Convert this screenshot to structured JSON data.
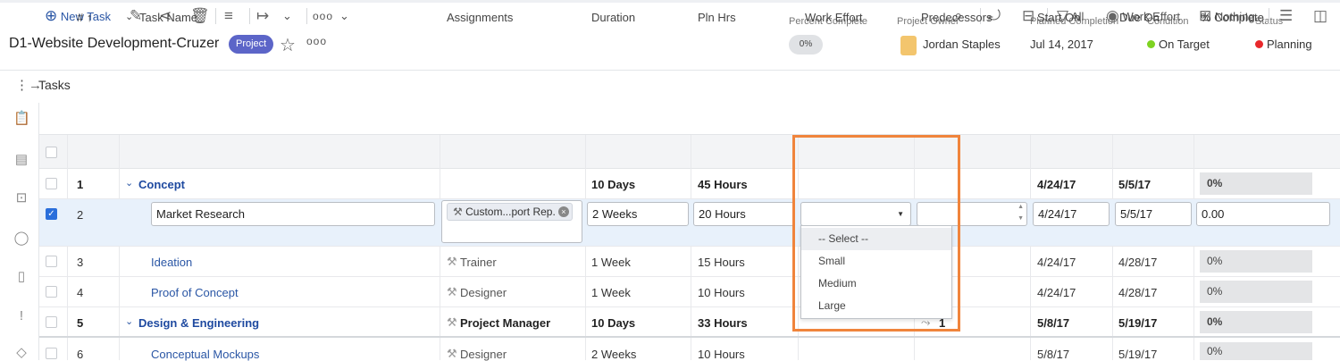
{
  "project": {
    "title": "D1-Website Development-Cruzer",
    "badge": "Project",
    "more": "ooo",
    "percent_complete_label": "Percent Complete",
    "percent_complete": "0%",
    "owner_label": "Project Owner",
    "owner": "Jordan Staples",
    "planned_label": "Planned Completion",
    "planned": "Jul 14, 2017",
    "condition_label": "Condition",
    "condition": "On Target",
    "status_label": "Status",
    "status": "Planning"
  },
  "colors": {
    "condition": "#7ed321",
    "status": "#e8282b",
    "accent": "#2a56a5",
    "highlight": "#f0843c"
  },
  "section_title": "Tasks",
  "toolbar": {
    "new_task": "New Task",
    "more": "ooo",
    "filter": "All",
    "view": "Work Effort",
    "group": "Nothing"
  },
  "columns": [
    "# ↑",
    "Task Name",
    "Assignments",
    "Duration",
    "Pln Hrs",
    "Work Effort",
    "Predecessors",
    "Start On",
    "Due On",
    "% Complete"
  ],
  "rows": [
    {
      "num": "1",
      "name": "Concept",
      "assign": "",
      "duration": "10 Days",
      "hours": "45 Hours",
      "pred": "",
      "start": "4/24/17",
      "due": "5/5/17",
      "pct": "0%"
    },
    {
      "num": "2",
      "name": "Market Research",
      "assign": "Custom...port Rep.",
      "duration": "2 Weeks",
      "hours": "20 Hours",
      "pred": "",
      "start": "4/24/17",
      "due": "5/5/17",
      "pct": "0.00"
    },
    {
      "num": "3",
      "name": "Ideation",
      "assign": "Trainer",
      "duration": "1 Week",
      "hours": "15 Hours",
      "pred": "",
      "start": "4/24/17",
      "due": "4/28/17",
      "pct": "0%"
    },
    {
      "num": "4",
      "name": "Proof of Concept",
      "assign": "Designer",
      "duration": "1 Week",
      "hours": "10 Hours",
      "pred": "",
      "start": "4/24/17",
      "due": "4/28/17",
      "pct": "0%"
    },
    {
      "num": "5",
      "name": "Design & Engineering",
      "assign": "Project Manager",
      "duration": "10 Days",
      "hours": "33 Hours",
      "pred": "1",
      "start": "5/8/17",
      "due": "5/19/17",
      "pct": "0%"
    },
    {
      "num": "6",
      "name": "Conceptual Mockups",
      "assign": "Designer",
      "duration": "2 Weeks",
      "hours": "10 Hours",
      "pred": "",
      "start": "5/8/17",
      "due": "5/19/17",
      "pct": "0%"
    }
  ],
  "work_effort_dropdown": {
    "options": [
      "-- Select --",
      "Small",
      "Medium",
      "Large"
    ],
    "selected": "-- Select --"
  }
}
